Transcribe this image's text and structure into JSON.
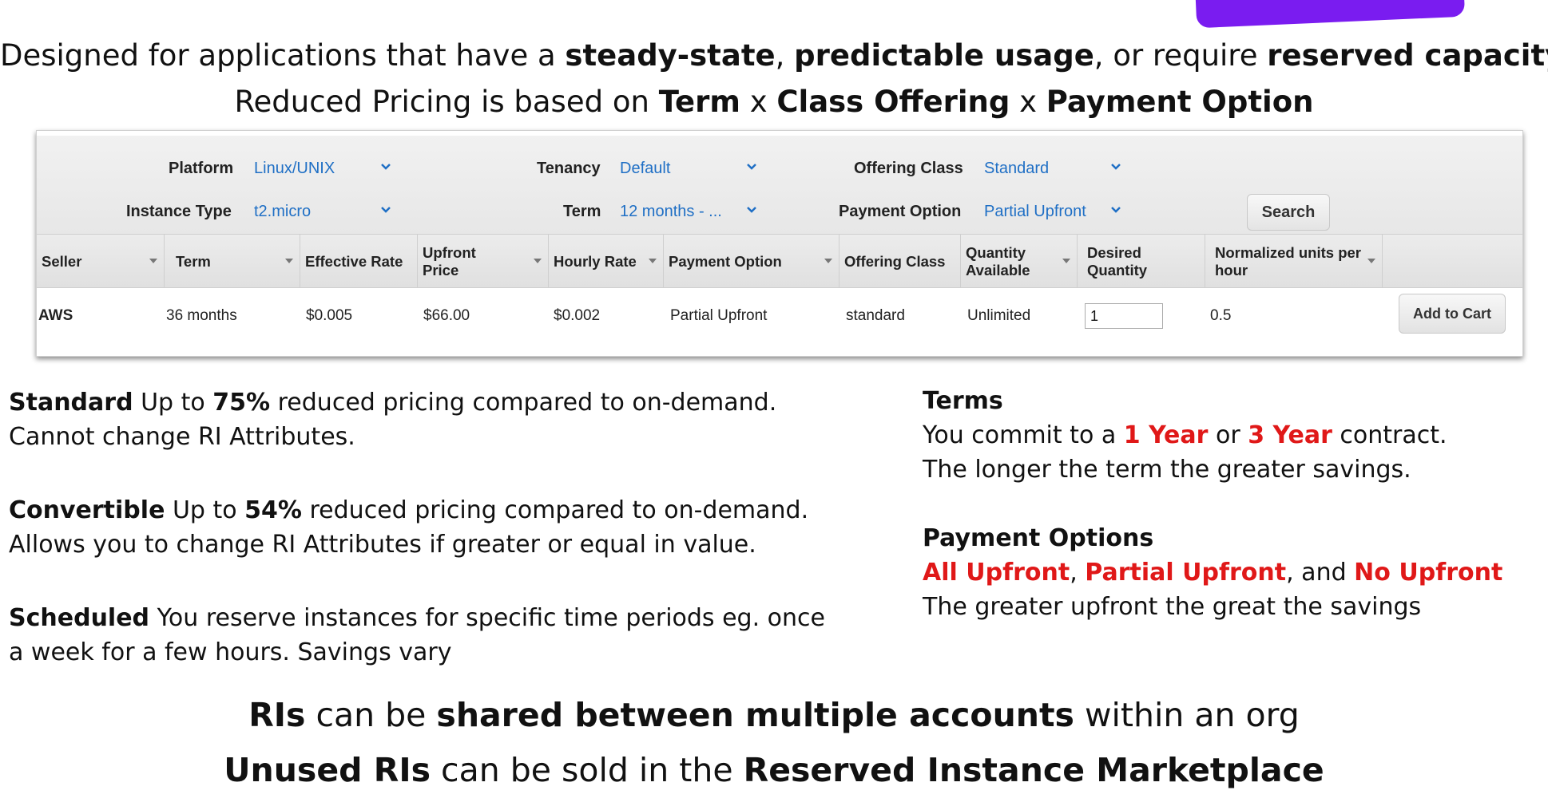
{
  "headline": {
    "line1": {
      "a": "Designed for applications that have a ",
      "b1": "steady-state",
      "c": ", ",
      "b2": "predictable usage",
      "d": ", or require ",
      "b3": "reserved capacity",
      "e": "."
    },
    "line2": {
      "a": "Reduced Pricing is based on ",
      "b1": "Term",
      "c": " x ",
      "b2": "Class Offering",
      "d": " x  ",
      "b3": "Payment Option"
    }
  },
  "filters": {
    "platform": {
      "label": "Platform",
      "value": "Linux/UNIX"
    },
    "tenancy": {
      "label": "Tenancy",
      "value": "Default"
    },
    "offering_class": {
      "label": "Offering Class",
      "value": "Standard"
    },
    "instance_type": {
      "label": "Instance Type",
      "value": "t2.micro"
    },
    "term": {
      "label": "Term",
      "value": "12 months - ..."
    },
    "payment_option": {
      "label": "Payment Option",
      "value": "Partial Upfront"
    },
    "search_label": "Search"
  },
  "table": {
    "headers": {
      "seller": "Seller",
      "term": "Term",
      "effective_rate": "Effective Rate",
      "upfront_price_1": "Upfront",
      "upfront_price_2": "Price",
      "hourly_rate": "Hourly Rate",
      "payment_option": "Payment Option",
      "offering_class": "Offering Class",
      "quantity_available_1": "Quantity",
      "quantity_available_2": "Available",
      "desired_quantity_1": "Desired",
      "desired_quantity_2": "Quantity",
      "normalized_units_1": "Normalized units per",
      "normalized_units_2": "hour"
    },
    "row": {
      "seller": "AWS",
      "term": "36 months",
      "effective_rate": "$0.005",
      "upfront_price": "$66.00",
      "hourly_rate": "$0.002",
      "payment_option": "Partial Upfront",
      "offering_class": "standard",
      "quantity_available": "Unlimited",
      "desired_quantity": "1",
      "normalized_units": "0.5",
      "add_to_cart": "Add to Cart"
    }
  },
  "classes": {
    "standard": {
      "name": "Standard",
      "t1": " Up to ",
      "pct": "75%",
      "t2": " reduced pricing compared to on-demand.",
      "line2": "Cannot change RI Attributes."
    },
    "convertible": {
      "name": "Convertible",
      "t1": " Up to ",
      "pct": "54%",
      "t2": " reduced pricing compared to on-demand.",
      "line2": "Allows you to change RI Attributes if greater or equal in value."
    },
    "scheduled": {
      "name": "Scheduled",
      "t1": " You reserve instances for specific time periods eg. once",
      "line2": "a week for a few hours. Savings vary"
    }
  },
  "terms": {
    "title": "Terms",
    "l1a": "You commit to a ",
    "one_year": "1 Year",
    "l1b": " or ",
    "three_year": "3 Year",
    "l1c": " contract.",
    "line2": "The longer the term the greater savings."
  },
  "payment_options": {
    "title": "Payment Options",
    "all": "All Upfront",
    "sep1": ", ",
    "partial": "Partial Upfront",
    "sep2": ", and ",
    "none": "No Upfront",
    "line3": "The greater upfront the great the savings"
  },
  "footer": {
    "line1": {
      "b1": "RIs",
      "a": " can be ",
      "b2": "shared between multiple accounts",
      "c": " within an org"
    },
    "line2": {
      "b1": "Unused RIs",
      "a": " can be sold in the ",
      "b2": "Reserved Instance Marketplace"
    }
  },
  "colors": {
    "accent_red": "#e01818",
    "link_blue": "#1f6fc5",
    "tab_purple": "#7a1cf0"
  }
}
